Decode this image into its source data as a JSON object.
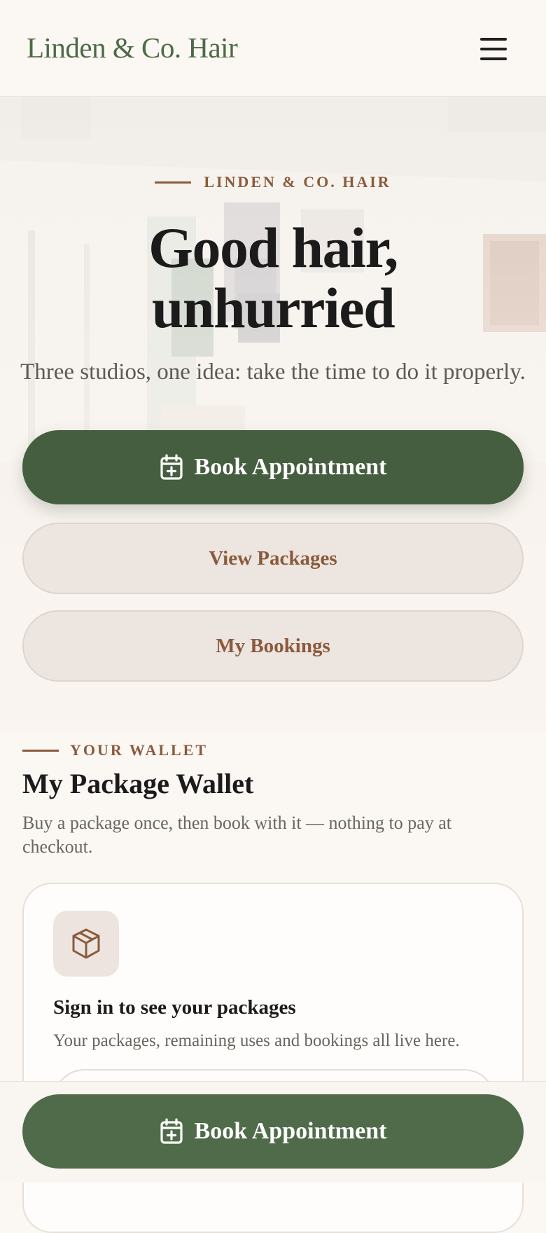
{
  "header": {
    "brand": "Linden & Co. Hair",
    "menu_icon": "hamburger-menu-icon"
  },
  "hero": {
    "eyebrow": "LINDEN & CO. HAIR",
    "title_line1": "Good hair,",
    "title_line2": "unhurried",
    "subtitle": "Three studios, one idea: take the time to do it properly.",
    "primary_button": {
      "label": "Book Appointment",
      "icon": "calendar-plus-icon"
    },
    "secondary_buttons": [
      {
        "label": "View Packages"
      },
      {
        "label": "My Bookings"
      }
    ]
  },
  "wallet": {
    "eyebrow": "YOUR WALLET",
    "title": "My Package Wallet",
    "description": "Buy a package once, then book with it — nothing to pay at checkout.",
    "card": {
      "icon": "package-box-icon",
      "title": "Sign in to see your packages",
      "description": "Your packages, remaining uses and bookings all live here."
    }
  },
  "bottom_bar": {
    "button_label": "Book Appointment",
    "icon": "calendar-plus-icon"
  },
  "colors": {
    "primary_green": "#455e3f",
    "accent_brown": "#8a5a3c",
    "background": "#fbf7f3"
  }
}
